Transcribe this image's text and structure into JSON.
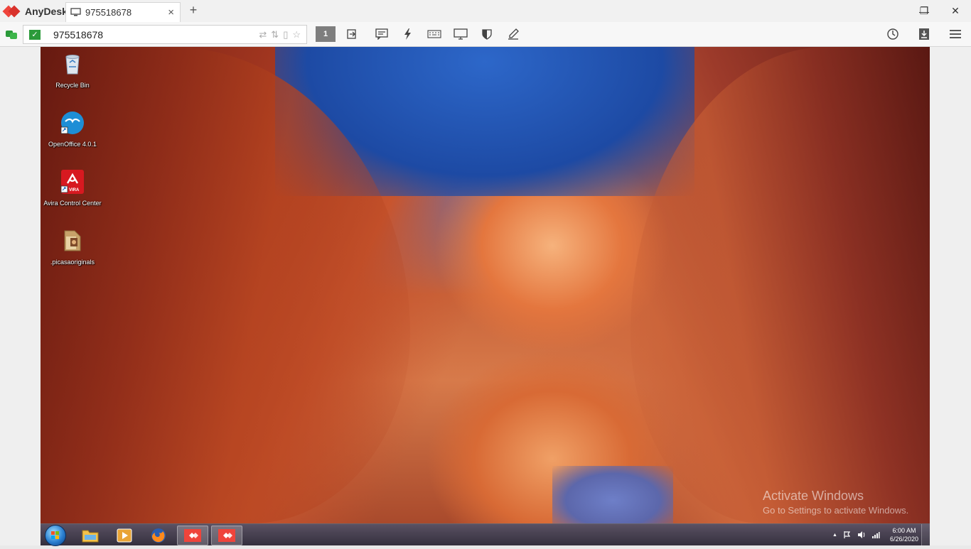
{
  "app": {
    "name": "AnyDesk",
    "tab_title": "975518678",
    "tab_close": "×",
    "new_tab": "+",
    "window_controls": [
      "—",
      "❐",
      "✕"
    ]
  },
  "toolbar": {
    "address_value": "975518678",
    "icons": [
      "monitor-1",
      "switch-sides",
      "chat",
      "actions",
      "keyboard",
      "display",
      "permissions",
      "whiteboard"
    ],
    "monitor_label": "1",
    "right_icons": [
      "history",
      "install",
      "menu"
    ]
  },
  "desktop": {
    "icons": [
      {
        "label": "Recycle Bin",
        "icon": "recycle-bin-icon"
      },
      {
        "label": "OpenOffice 4.0.1",
        "icon": "openoffice-icon"
      },
      {
        "label": "Avira Control Center",
        "icon": "avira-icon"
      },
      {
        "label": ".picasaoriginals",
        "icon": "folder-icon"
      }
    ],
    "watermark_title": "Activate Windows",
    "watermark_subtitle": "Go to Settings to activate Windows."
  },
  "taskbar": {
    "apps": [
      "file-explorer",
      "media-player",
      "firefox",
      "anydesk",
      "anydesk"
    ],
    "tray_arrow": "▲",
    "time": "6:00 AM",
    "date": "6/26/2020"
  },
  "colors": {
    "anydesk_red": "#ef443b",
    "toolbar_bg": "#f7f7f7",
    "status_green": "#2b9a3a"
  }
}
